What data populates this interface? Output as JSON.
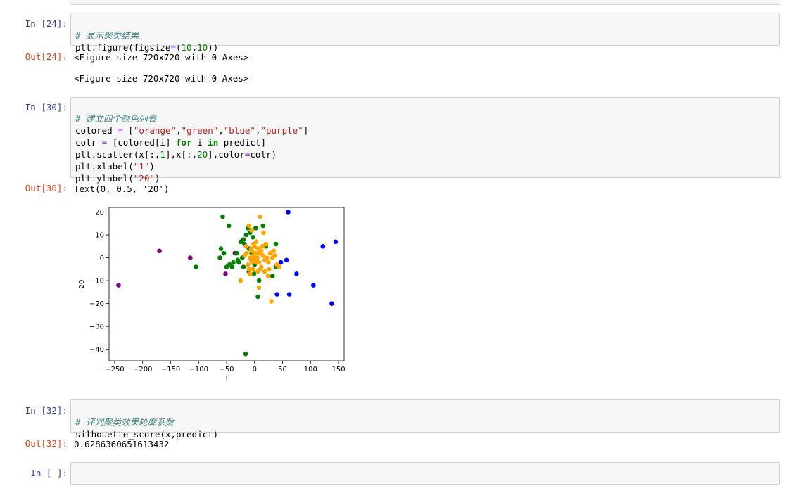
{
  "cells": {
    "c24": {
      "in_prompt": "In  [24]:",
      "comment": "# 显示聚类结果",
      "line2_fn": "plt.figure(figsize",
      "line2_eq": "=",
      "line2_open": "(",
      "line2_n1": "10",
      "line2_sep": ",",
      "line2_n2": "10",
      "line2_close": "))",
      "out_prompt": "Out[24]:",
      "out1": "<Figure size 720x720 with 0 Axes>",
      "out2": "<Figure size 720x720 with 0 Axes>"
    },
    "c30": {
      "in_prompt": "In  [30]:",
      "comment": "# 建立四个颜色列表",
      "l2_a": "colored ",
      "l2_eq": "=",
      "l2_b": " [",
      "l2_s1": "\"orange\"",
      "l2_s2": "\"green\"",
      "l2_s3": "\"blue\"",
      "l2_s4": "\"purple\"",
      "l2_c": "]",
      "l3_a": "colr ",
      "l3_eq": "=",
      "l3_b": " [colored[i] ",
      "l3_for": "for",
      "l3_c": " i ",
      "l3_in": "in",
      "l3_d": " predict]",
      "l4_a": "plt.scatter(x[:,",
      "l4_n1": "1",
      "l4_b": "],x[:,",
      "l4_n2": "20",
      "l4_c": "],color",
      "l4_eq": "=",
      "l4_d": "colr)",
      "l5_a": "plt.xlabel(",
      "l5_s": "\"1\"",
      "l5_b": ")",
      "l6_a": "plt.ylabel(",
      "l6_s": "\"20\"",
      "l6_b": ")",
      "out_prompt": "Out[30]:",
      "out1": "Text(0, 0.5, '20')"
    },
    "c32": {
      "in_prompt": "In  [32]:",
      "comment": "# 评判聚类效果轮廓系数",
      "line2_a": "silhouette_score(x,predict)",
      "out_prompt": "Out[32]:",
      "out1": "0.6286360651613432"
    },
    "empty": {
      "in_prompt": "In  [ ]:"
    }
  },
  "chart_data": {
    "type": "scatter",
    "xlabel": "1",
    "ylabel": "20",
    "xlim": [
      -260,
      160
    ],
    "ylim": [
      -45,
      22
    ],
    "xticks": [
      -250,
      -200,
      -150,
      -100,
      -50,
      0,
      50,
      100,
      150
    ],
    "yticks": [
      20,
      10,
      0,
      -10,
      -20,
      -30,
      -40
    ],
    "grid": false,
    "colors": {
      "orange": "#ffa500",
      "green": "#008000",
      "blue": "#0000ff",
      "purple": "#800080"
    },
    "series": [
      {
        "color": "purple",
        "points": [
          [
            -243,
            -12
          ],
          [
            -170,
            3
          ],
          [
            -115,
            0
          ],
          [
            -52,
            -7
          ],
          [
            -35,
            2
          ]
        ]
      },
      {
        "color": "blue",
        "points": [
          [
            60,
            20
          ],
          [
            122,
            5
          ],
          [
            145,
            7
          ],
          [
            47,
            -2
          ],
          [
            57,
            -1
          ],
          [
            75,
            -7
          ],
          [
            40,
            -16
          ],
          [
            62,
            -16
          ],
          [
            105,
            -12
          ],
          [
            138,
            -20
          ]
        ]
      },
      {
        "color": "green",
        "points": [
          [
            -57,
            18
          ],
          [
            -46,
            14
          ],
          [
            -105,
            -4
          ],
          [
            -60,
            4
          ],
          [
            -62,
            0
          ],
          [
            -55,
            2
          ],
          [
            -50,
            -4
          ],
          [
            -45,
            -3
          ],
          [
            -40,
            -4
          ],
          [
            -38,
            -2
          ],
          [
            -30,
            -1
          ],
          [
            -25,
            7
          ],
          [
            -20,
            8
          ],
          [
            -18,
            6
          ],
          [
            -15,
            10
          ],
          [
            -12,
            13
          ],
          [
            -8,
            11
          ],
          [
            -5,
            12
          ],
          [
            -3,
            9
          ],
          [
            2,
            13
          ],
          [
            15,
            14
          ],
          [
            -22,
            0
          ],
          [
            -28,
            -2
          ],
          [
            -32,
            2
          ],
          [
            -10,
            4
          ],
          [
            -5,
            2
          ],
          [
            0,
            -3
          ],
          [
            8,
            -10
          ],
          [
            6,
            -17
          ],
          [
            -16,
            -42
          ],
          [
            38,
            6
          ],
          [
            38,
            -4
          ],
          [
            32,
            -8
          ],
          [
            20,
            5
          ],
          [
            -1,
            -7
          ],
          [
            -20,
            -4
          ],
          [
            -10,
            -6
          ]
        ]
      },
      {
        "color": "orange",
        "points": [
          [
            -10,
            14
          ],
          [
            10,
            18
          ],
          [
            16,
            11
          ],
          [
            -5,
            12
          ],
          [
            0,
            5
          ],
          [
            -5,
            3
          ],
          [
            2,
            2
          ],
          [
            5,
            0
          ],
          [
            8,
            -2
          ],
          [
            -8,
            0
          ],
          [
            12,
            3
          ],
          [
            15,
            1
          ],
          [
            18,
            -1
          ],
          [
            22,
            0
          ],
          [
            25,
            -2
          ],
          [
            28,
            2
          ],
          [
            32,
            0
          ],
          [
            36,
            1
          ],
          [
            40,
            -3
          ],
          [
            44,
            -4
          ],
          [
            30,
            -19
          ],
          [
            8,
            -13
          ],
          [
            -25,
            -10
          ],
          [
            -3,
            -5
          ],
          [
            -8,
            -7
          ],
          [
            6,
            -6
          ],
          [
            10,
            -5
          ],
          [
            -2,
            6
          ],
          [
            3,
            7
          ],
          [
            -6,
            4
          ],
          [
            0,
            0
          ],
          [
            4,
            -2
          ],
          [
            -4,
            -2
          ],
          [
            12,
            -4
          ],
          [
            18,
            -6
          ],
          [
            24,
            -8
          ],
          [
            20,
            6
          ],
          [
            14,
            5
          ],
          [
            -14,
            2
          ],
          [
            -12,
            -3
          ],
          [
            -15,
            5
          ],
          [
            6,
            4
          ],
          [
            -2,
            1
          ],
          [
            2,
            -1
          ],
          [
            8,
            2
          ],
          [
            -6,
            -1
          ],
          [
            26,
            -5
          ],
          [
            34,
            3
          ],
          [
            -18,
            1
          ],
          [
            -10,
            -5
          ]
        ]
      }
    ]
  }
}
